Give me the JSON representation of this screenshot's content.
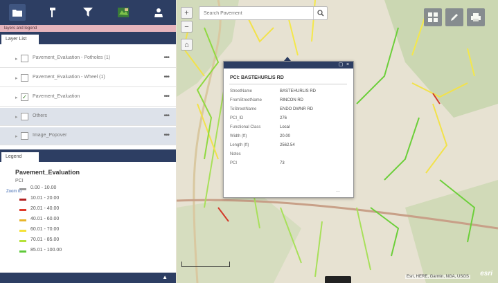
{
  "toolbar": {
    "buttons": [
      {
        "name": "layer-list-icon"
      },
      {
        "name": "basemap-icon"
      },
      {
        "name": "filter-icon"
      },
      {
        "name": "map-icon"
      },
      {
        "name": "user-icon"
      }
    ]
  },
  "panel_header": "layers and legend",
  "layer_tab": "Layer List",
  "layers": [
    {
      "label": "Pavement_Evaluation - Potholes (1)",
      "checked": false,
      "highlight": false
    },
    {
      "label": "Pavement_Evaluation - Wheel (1)",
      "checked": false,
      "highlight": false
    },
    {
      "label": "Pavement_Evaluation",
      "checked": true,
      "highlight": false
    },
    {
      "label": "Others",
      "checked": false,
      "highlight": true
    },
    {
      "label": "Image_Popover",
      "checked": false,
      "highlight": true
    }
  ],
  "legend_tab": "Legend",
  "legend": {
    "title": "Pavement_Evaluation",
    "field": "PCI",
    "classes": [
      {
        "range": "0.00 - 10.00",
        "color": "#9a9a9a"
      },
      {
        "range": "10.01 - 20.00",
        "color": "#b22222"
      },
      {
        "range": "20.01 - 40.00",
        "color": "#e03a2a"
      },
      {
        "range": "40.01 - 60.00",
        "color": "#e8b52a"
      },
      {
        "range": "60.01 - 70.00",
        "color": "#f4e23a"
      },
      {
        "range": "70.01 - 85.00",
        "color": "#b5e13a"
      },
      {
        "range": "85.01 - 100.00",
        "color": "#5fc93a"
      }
    ]
  },
  "footer_arrow": "▲",
  "search": {
    "placeholder": "Search Pavement"
  },
  "popup": {
    "title": "PCI: BASTEHURLIS RD",
    "fields": [
      {
        "key": "StreetName",
        "value": "BASTEHURLIS RD"
      },
      {
        "key": "FromStreetName",
        "value": "RINCON RD"
      },
      {
        "key": "ToStreetName",
        "value": "ENDO DWNR RD"
      },
      {
        "key": "PCI_ID",
        "value": "276"
      },
      {
        "key": "Functional Class",
        "value": "Local"
      },
      {
        "key": "Width (ft)",
        "value": "20.00"
      },
      {
        "key": "Length (ft)",
        "value": "2562.54"
      },
      {
        "key": "Notes",
        "value": ""
      },
      {
        "key": "PCI",
        "value": "73"
      }
    ],
    "zoom_link": "Zoom to",
    "more": "..."
  },
  "attribution": "Esri, HERE, Garmin, NGA, USGS",
  "esri_logo": "esri"
}
